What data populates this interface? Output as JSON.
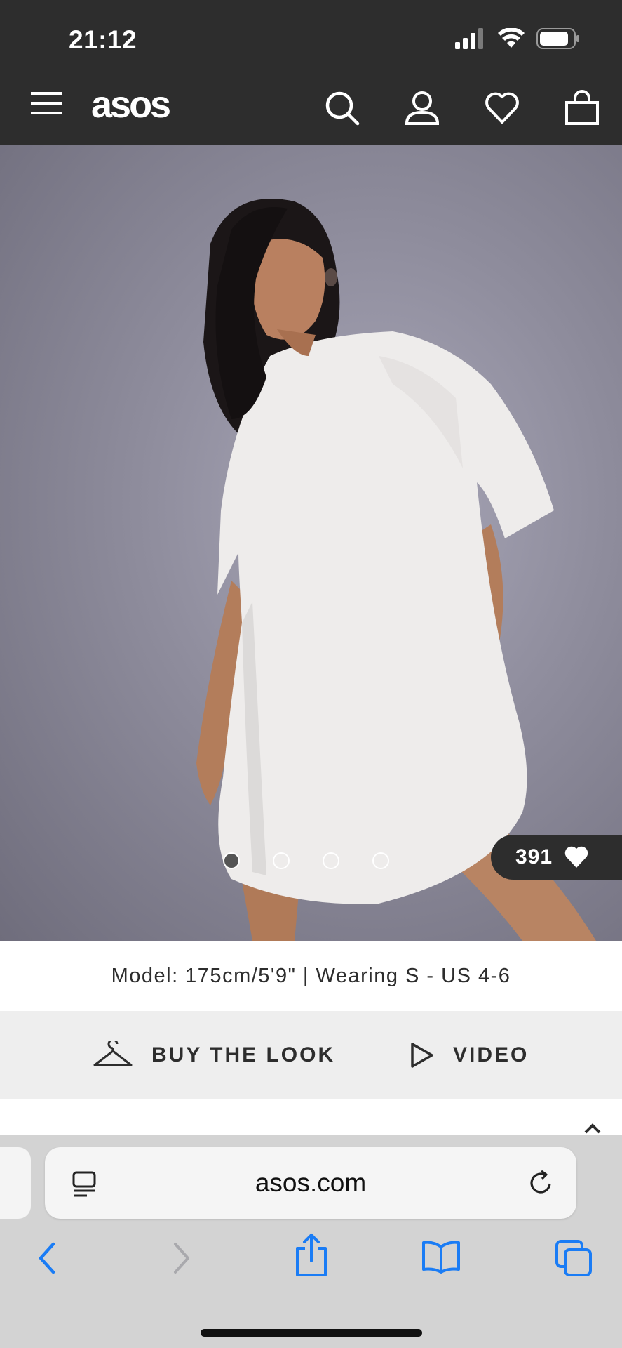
{
  "status_bar": {
    "time": "21:12"
  },
  "header": {
    "logo": "asos",
    "icons": [
      "menu-icon",
      "search-icon",
      "account-icon",
      "heart-icon",
      "bag-icon"
    ]
  },
  "gallery": {
    "dot_count": 4,
    "active_dot": 1,
    "likes": "391"
  },
  "model_info": "Model: 175cm/5'9\" | Wearing S - US 4-6",
  "actions": {
    "buy_the_look": "BUY THE LOOK",
    "video": "VIDEO"
  },
  "browser": {
    "url": "asos.com",
    "accent": "#1a7cf5"
  },
  "colors": {
    "header_bg": "#2d2d2d",
    "action_bg": "#eeeeee"
  }
}
